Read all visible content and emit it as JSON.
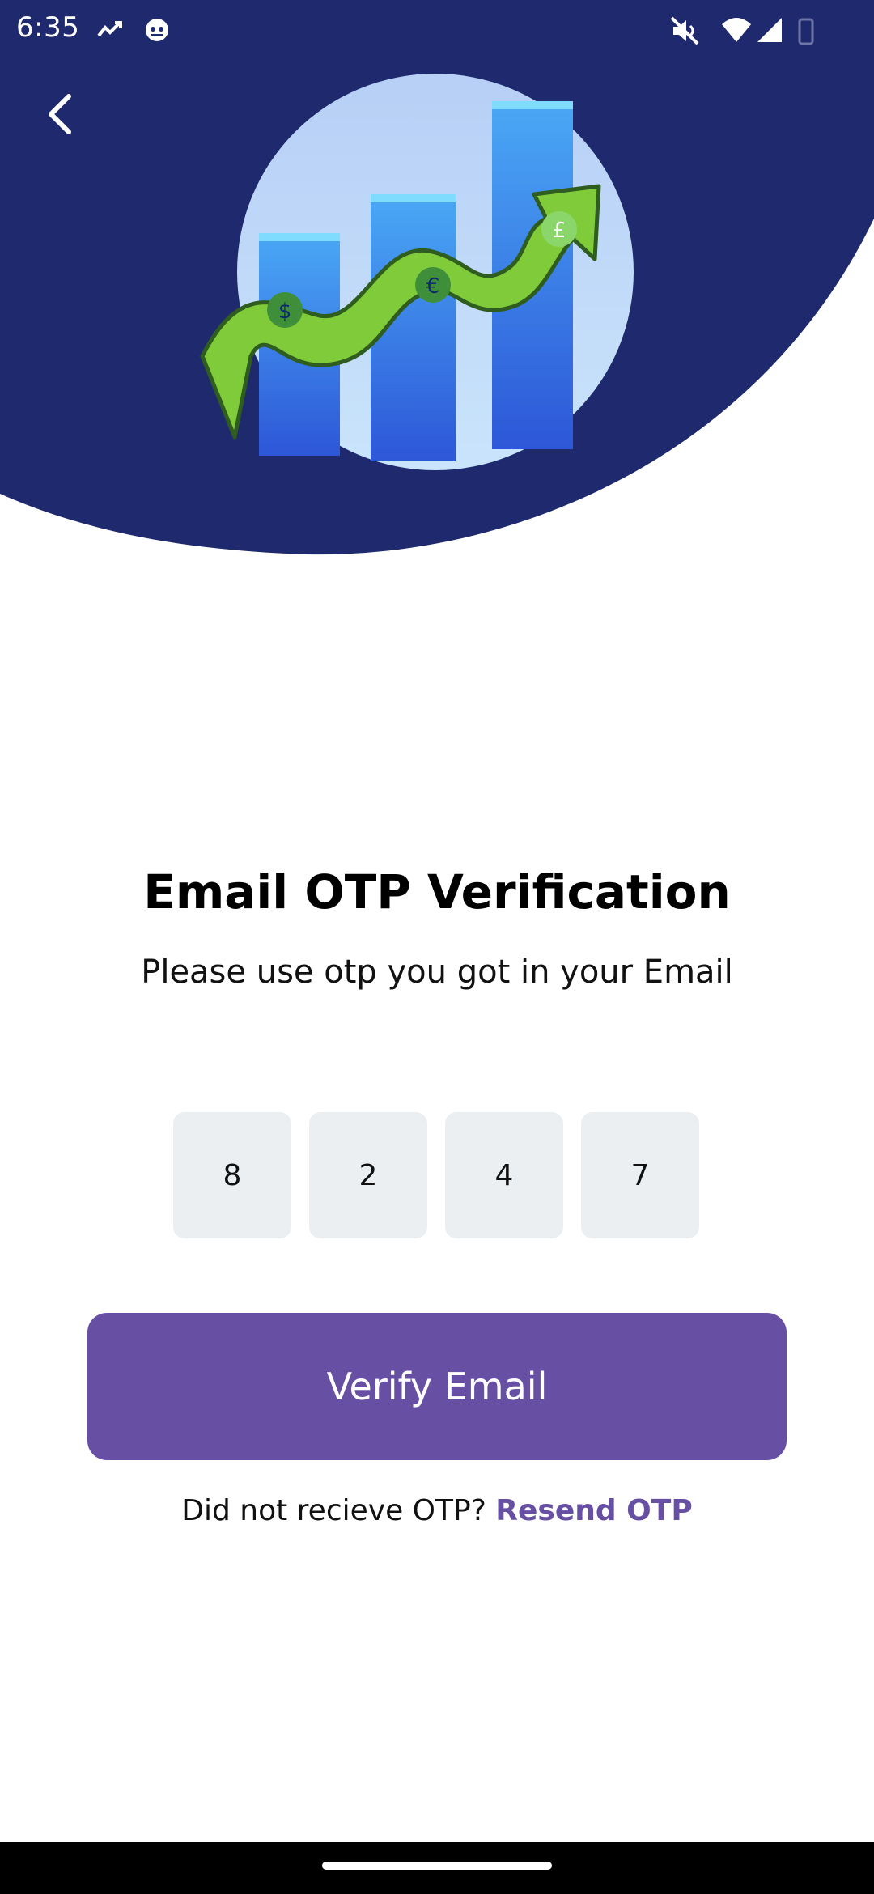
{
  "status_bar": {
    "time": "6:35",
    "icons": [
      "trend-icon",
      "bot-icon",
      "mute-icon",
      "wifi-icon",
      "signal-icon",
      "battery-icon"
    ]
  },
  "header": {
    "back_icon": "chevron-left-icon",
    "illustration": "growth-chart-money-illustration",
    "background_color": "#1f2a6e"
  },
  "main": {
    "title": "Email OTP Verification",
    "subtitle": "Please use otp you got in your Email",
    "otp_digits": [
      "8",
      "2",
      "4",
      "7"
    ],
    "verify_button_label": "Verify Email",
    "resend_prompt": "Did not recieve OTP?",
    "resend_link": "Resend OTP"
  },
  "colors": {
    "primary": "#6750a4",
    "header_bg": "#1f2a6e",
    "otp_box_bg": "#eceff2"
  }
}
